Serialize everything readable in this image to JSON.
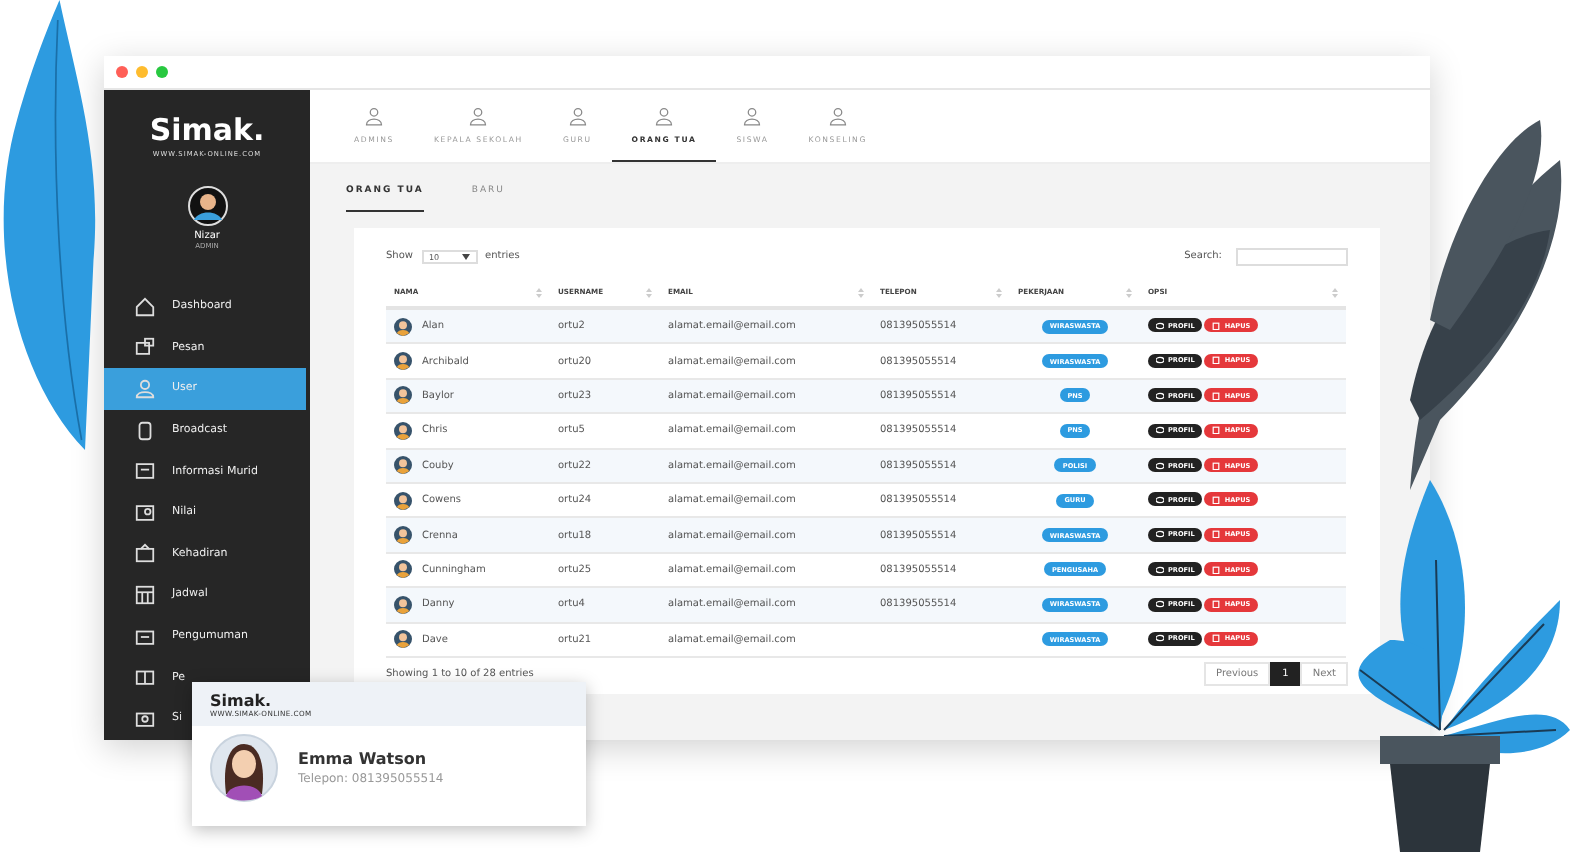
{
  "sidebar": {
    "logo": "Simak.",
    "logo_url": "WWW.SIMAK-ONLINE.COM",
    "user": {
      "name": "Nizar",
      "role": "ADMIN"
    },
    "items": [
      {
        "label": "Dashboard",
        "selected": false
      },
      {
        "label": "Pesan",
        "selected": false
      },
      {
        "label": "User",
        "selected": true
      },
      {
        "label": "Broadcast",
        "selected": false
      },
      {
        "label": "Informasi Murid",
        "selected": false
      },
      {
        "label": "Nilai",
        "selected": false
      },
      {
        "label": "Kehadiran",
        "selected": false
      },
      {
        "label": "Jadwal",
        "selected": false
      },
      {
        "label": "Pengumuman",
        "selected": false
      },
      {
        "label": "Pe",
        "selected": false
      },
      {
        "label": "Si",
        "selected": false
      }
    ]
  },
  "tabs": [
    {
      "label": "ADMINS",
      "selected": false
    },
    {
      "label": "KEPALA SEKOLAH",
      "selected": false
    },
    {
      "label": "GURU",
      "selected": false
    },
    {
      "label": "ORANG TUA",
      "selected": true
    },
    {
      "label": "SISWA",
      "selected": false
    },
    {
      "label": "KONSELING",
      "selected": false
    }
  ],
  "subtabs": [
    {
      "label": "ORANG TUA",
      "selected": true
    },
    {
      "label": "BARU",
      "selected": false
    }
  ],
  "table": {
    "show_label": "Show",
    "page_size": "10",
    "entries_label": "entries",
    "search_label": "Search:",
    "columns": [
      "NAMA",
      "USERNAME",
      "EMAIL",
      "TELEPON",
      "PEKERJAAN",
      "OPSI"
    ],
    "rows": [
      {
        "name": "Alan",
        "username": "ortu2",
        "email": "alamat.email@email.com",
        "phone": "081395055514",
        "job": "WIRASWASTA",
        "profile_button": "PROFIL",
        "delete_button": "HAPUS"
      },
      {
        "name": "Archibald",
        "username": "ortu20",
        "email": "alamat.email@email.com",
        "phone": "081395055514",
        "job": "WIRASWASTA",
        "profile_button": "PROFIL",
        "delete_button": "HAPUS"
      },
      {
        "name": "Baylor",
        "username": "ortu23",
        "email": "alamat.email@email.com",
        "phone": "081395055514",
        "job": "PNS",
        "profile_button": "PROFIL",
        "delete_button": "HAPUS"
      },
      {
        "name": "Chris",
        "username": "ortu5",
        "email": "alamat.email@email.com",
        "phone": "081395055514",
        "job": "PNS",
        "profile_button": "PROFIL",
        "delete_button": "HAPUS"
      },
      {
        "name": "Couby",
        "username": "ortu22",
        "email": "alamat.email@email.com",
        "phone": "081395055514",
        "job": "POLISI",
        "profile_button": "PROFIL",
        "delete_button": "HAPUS"
      },
      {
        "name": "Cowens",
        "username": "ortu24",
        "email": "alamat.email@email.com",
        "phone": "081395055514",
        "job": "GURU",
        "profile_button": "PROFIL",
        "delete_button": "HAPUS"
      },
      {
        "name": "Crenna",
        "username": "ortu18",
        "email": "alamat.email@email.com",
        "phone": "081395055514",
        "job": "WIRASWASTA",
        "profile_button": "PROFIL",
        "delete_button": "HAPUS"
      },
      {
        "name": "Cunningham",
        "username": "ortu25",
        "email": "alamat.email@email.com",
        "phone": "081395055514",
        "job": "PENGUSAHA",
        "profile_button": "PROFIL",
        "delete_button": "HAPUS"
      },
      {
        "name": "Danny",
        "username": "ortu4",
        "email": "alamat.email@email.com",
        "phone": "081395055514",
        "job": "WIRASWASTA",
        "profile_button": "PROFIL",
        "delete_button": "HAPUS"
      },
      {
        "name": "Dave",
        "username": "ortu21",
        "email": "alamat.email@email.com",
        "job": "WIRASWASTA",
        "profile_button": "PROFIL",
        "delete_button": "HAPUS"
      }
    ],
    "info": "Showing 1 to 10 of 28 entries",
    "pagination": [
      {
        "label": "Previous",
        "selected": false
      },
      {
        "label": "1",
        "selected": true
      },
      {
        "label": "Next",
        "selected": false
      }
    ]
  },
  "profile_card": {
    "logo": "Simak.",
    "logo_url": "WWW.SIMAK-ONLINE.COM",
    "name": "Emma Watson",
    "phone": "Telepon: 081395055514"
  }
}
